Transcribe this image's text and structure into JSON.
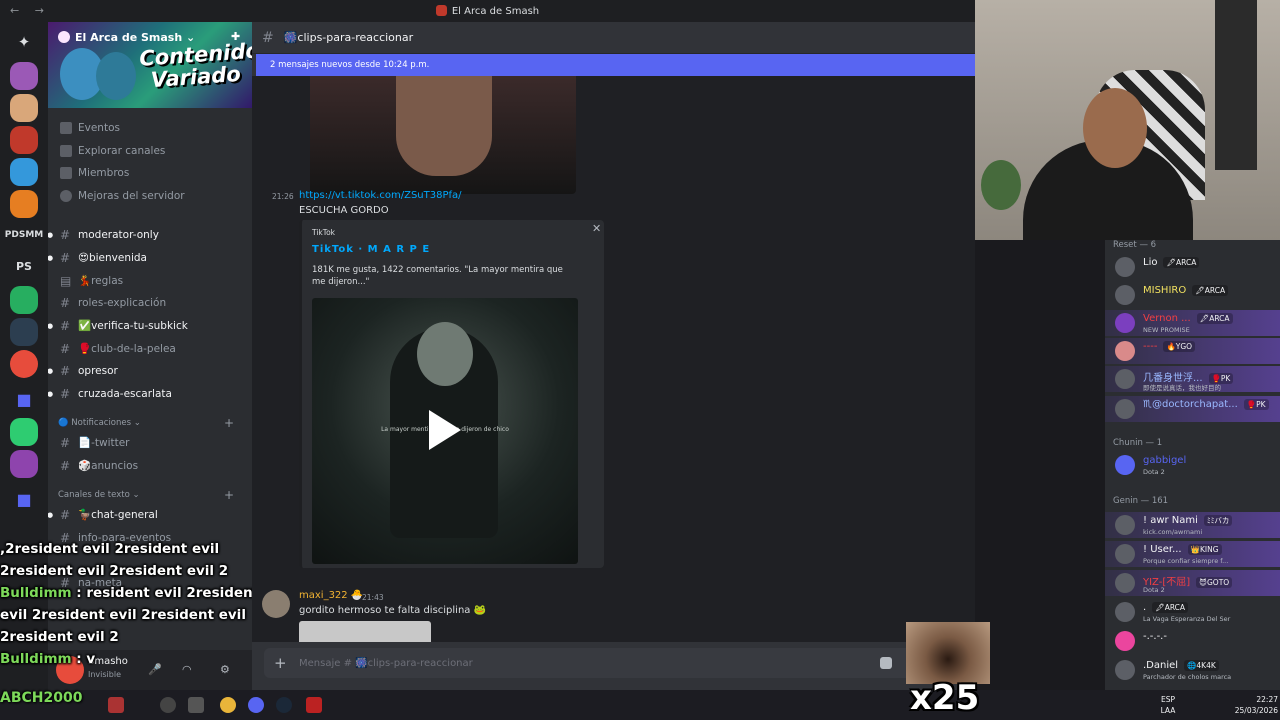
{
  "window": {
    "title": "El Arca de Smash",
    "nav": "← →"
  },
  "server": {
    "name": "El Arca de Smash ⌄",
    "banner_text": "Contenido Variado"
  },
  "sidebar": {
    "menu": [
      "Eventos",
      "Explorar canales",
      "Miembros",
      "Mejoras del servidor"
    ],
    "channels": [
      {
        "label": "moderator-only",
        "bright": true
      },
      {
        "label": "😍bienvenida",
        "bright": true
      },
      {
        "label": "💃reglas",
        "bright": false
      },
      {
        "label": "roles-explicación",
        "bright": false
      },
      {
        "label": "✅verifica-tu-subkick",
        "bright": true
      },
      {
        "label": "🥊club-de-la-pelea",
        "bright": false
      },
      {
        "label": "opresor",
        "bright": true
      },
      {
        "label": "cruzada-escarlata",
        "bright": true
      }
    ],
    "cat_notifications": "🔵 Notificaciones ⌄",
    "notif_channels": [
      "📄-twitter",
      "🎲anuncios"
    ],
    "cat_text": "Canales de texto ⌄",
    "text_channels": [
      "🦆chat-general",
      "info-para-eventos",
      "na-meta"
    ],
    "guild_labels": {
      "pdsmm": "PDSMM",
      "ps": "PS"
    }
  },
  "overlay_chat": {
    "line1": ",2resident evil 2resident evil 2resident evil 2resident evil 2",
    "nick": "Bulldimm",
    "line2": ": resident evil 2resident evil 2resident evil 2resident evil 2resident evil 2",
    "line3": ": v",
    "footer": "ABCH2000"
  },
  "userbar": {
    "name": "Smasho",
    "status": "Invisible"
  },
  "chat": {
    "channel": "🎆clips-para-reaccionar",
    "new_messages": "2 mensajes nuevos desde 10:24 p.m.",
    "msg1": {
      "time": "21:26",
      "link": "https://vt.tiktok.com/ZSuT38Pfa/",
      "text": "ESCUCHA GORDO"
    },
    "embed": {
      "provider": "TikTok",
      "title": "TikTok · M A R P E",
      "description": "181K me gusta, 1422 comentarios. \"La mayor mentira que me dijeron...\"",
      "video_caption": "La mayor mentira que me dijeron de chico"
    },
    "msg2": {
      "user": "maxi_322 🐣",
      "time": "21:43",
      "text": "gordito hermoso te falta disciplina 🐸"
    },
    "composer_placeholder": "Mensaje # 🎆clips-para-reaccionar"
  },
  "members": {
    "cat_reset": "Reset — 6",
    "reset": [
      {
        "name": "Lio",
        "tag": "🖋ARCA",
        "status": "",
        "boost": false
      },
      {
        "name": "MISHIRO",
        "tag": "🖋ARCA",
        "status": "",
        "boost": false
      },
      {
        "name": "Vernon ...",
        "tag": "🖋ARCA",
        "status": "NEW PROMISE",
        "boost": true
      },
      {
        "name": "----",
        "tag": "🔥YGO",
        "status": "",
        "boost": true
      },
      {
        "name": "几番身世浮...",
        "tag": "🥊PK",
        "status": "即使是说真话，我也好目的",
        "boost": true
      },
      {
        "name": "♏@doctorchapat...",
        "tag": "🥊PK",
        "status": "",
        "boost": true
      }
    ],
    "cat_chunin": "Chunin — 1",
    "chunin": [
      {
        "name": "gabbigel",
        "tag": "",
        "status": "Dota 2",
        "boost": false
      }
    ],
    "cat_genin": "Genin — 161",
    "genin": [
      {
        "name": "! awr Nami",
        "tag": "ﾐﾐバカ",
        "status": "kick.com/awrnami",
        "boost": true
      },
      {
        "name": "! User...",
        "tag": "👑KING",
        "status": "Porque confiar siempre f...",
        "boost": true
      },
      {
        "name": "YIZ-[不屈]",
        "tag": "😈GOTO",
        "status": "Dota 2",
        "boost": true
      },
      {
        "name": ".",
        "tag": "🖋ARCA",
        "status": "La Vaga Esperanza Del Ser",
        "boost": false
      },
      {
        "name": "-.-.-.-",
        "tag": "",
        "status": "",
        "boost": false
      },
      {
        "name": ".Daniel",
        "tag": "🌐4K4K",
        "status": "Parchador de cholos marca",
        "boost": false
      }
    ]
  },
  "taskbar": {
    "lang": "ESP",
    "lang2": "LAA",
    "time": "22:27",
    "date": "25/03/2026"
  },
  "emote": {
    "text": "x25"
  },
  "colors": {
    "accent": "#5865f2",
    "link": "#00a8fc",
    "overlay_nick": "#7dd95a"
  }
}
